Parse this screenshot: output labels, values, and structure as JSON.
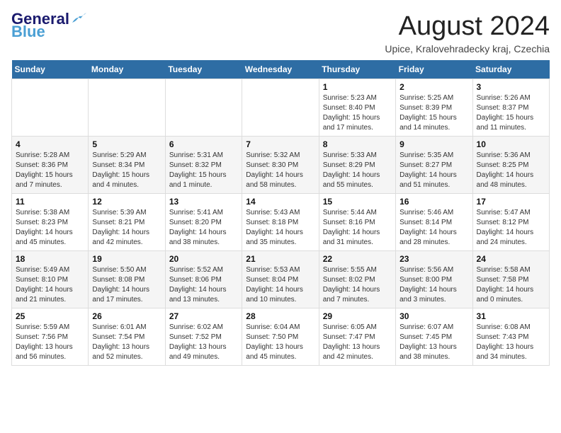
{
  "header": {
    "logo_line1": "General",
    "logo_line2": "Blue",
    "month_title": "August 2024",
    "location": "Upice, Kralovehradecky kraj, Czechia"
  },
  "weekdays": [
    "Sunday",
    "Monday",
    "Tuesday",
    "Wednesday",
    "Thursday",
    "Friday",
    "Saturday"
  ],
  "weeks": [
    [
      {
        "day": "",
        "info": ""
      },
      {
        "day": "",
        "info": ""
      },
      {
        "day": "",
        "info": ""
      },
      {
        "day": "",
        "info": ""
      },
      {
        "day": "1",
        "info": "Sunrise: 5:23 AM\nSunset: 8:40 PM\nDaylight: 15 hours and 17 minutes."
      },
      {
        "day": "2",
        "info": "Sunrise: 5:25 AM\nSunset: 8:39 PM\nDaylight: 15 hours and 14 minutes."
      },
      {
        "day": "3",
        "info": "Sunrise: 5:26 AM\nSunset: 8:37 PM\nDaylight: 15 hours and 11 minutes."
      }
    ],
    [
      {
        "day": "4",
        "info": "Sunrise: 5:28 AM\nSunset: 8:36 PM\nDaylight: 15 hours and 7 minutes."
      },
      {
        "day": "5",
        "info": "Sunrise: 5:29 AM\nSunset: 8:34 PM\nDaylight: 15 hours and 4 minutes."
      },
      {
        "day": "6",
        "info": "Sunrise: 5:31 AM\nSunset: 8:32 PM\nDaylight: 15 hours and 1 minute."
      },
      {
        "day": "7",
        "info": "Sunrise: 5:32 AM\nSunset: 8:30 PM\nDaylight: 14 hours and 58 minutes."
      },
      {
        "day": "8",
        "info": "Sunrise: 5:33 AM\nSunset: 8:29 PM\nDaylight: 14 hours and 55 minutes."
      },
      {
        "day": "9",
        "info": "Sunrise: 5:35 AM\nSunset: 8:27 PM\nDaylight: 14 hours and 51 minutes."
      },
      {
        "day": "10",
        "info": "Sunrise: 5:36 AM\nSunset: 8:25 PM\nDaylight: 14 hours and 48 minutes."
      }
    ],
    [
      {
        "day": "11",
        "info": "Sunrise: 5:38 AM\nSunset: 8:23 PM\nDaylight: 14 hours and 45 minutes."
      },
      {
        "day": "12",
        "info": "Sunrise: 5:39 AM\nSunset: 8:21 PM\nDaylight: 14 hours and 42 minutes."
      },
      {
        "day": "13",
        "info": "Sunrise: 5:41 AM\nSunset: 8:20 PM\nDaylight: 14 hours and 38 minutes."
      },
      {
        "day": "14",
        "info": "Sunrise: 5:43 AM\nSunset: 8:18 PM\nDaylight: 14 hours and 35 minutes."
      },
      {
        "day": "15",
        "info": "Sunrise: 5:44 AM\nSunset: 8:16 PM\nDaylight: 14 hours and 31 minutes."
      },
      {
        "day": "16",
        "info": "Sunrise: 5:46 AM\nSunset: 8:14 PM\nDaylight: 14 hours and 28 minutes."
      },
      {
        "day": "17",
        "info": "Sunrise: 5:47 AM\nSunset: 8:12 PM\nDaylight: 14 hours and 24 minutes."
      }
    ],
    [
      {
        "day": "18",
        "info": "Sunrise: 5:49 AM\nSunset: 8:10 PM\nDaylight: 14 hours and 21 minutes."
      },
      {
        "day": "19",
        "info": "Sunrise: 5:50 AM\nSunset: 8:08 PM\nDaylight: 14 hours and 17 minutes."
      },
      {
        "day": "20",
        "info": "Sunrise: 5:52 AM\nSunset: 8:06 PM\nDaylight: 14 hours and 13 minutes."
      },
      {
        "day": "21",
        "info": "Sunrise: 5:53 AM\nSunset: 8:04 PM\nDaylight: 14 hours and 10 minutes."
      },
      {
        "day": "22",
        "info": "Sunrise: 5:55 AM\nSunset: 8:02 PM\nDaylight: 14 hours and 7 minutes."
      },
      {
        "day": "23",
        "info": "Sunrise: 5:56 AM\nSunset: 8:00 PM\nDaylight: 14 hours and 3 minutes."
      },
      {
        "day": "24",
        "info": "Sunrise: 5:58 AM\nSunset: 7:58 PM\nDaylight: 14 hours and 0 minutes."
      }
    ],
    [
      {
        "day": "25",
        "info": "Sunrise: 5:59 AM\nSunset: 7:56 PM\nDaylight: 13 hours and 56 minutes."
      },
      {
        "day": "26",
        "info": "Sunrise: 6:01 AM\nSunset: 7:54 PM\nDaylight: 13 hours and 52 minutes."
      },
      {
        "day": "27",
        "info": "Sunrise: 6:02 AM\nSunset: 7:52 PM\nDaylight: 13 hours and 49 minutes."
      },
      {
        "day": "28",
        "info": "Sunrise: 6:04 AM\nSunset: 7:50 PM\nDaylight: 13 hours and 45 minutes."
      },
      {
        "day": "29",
        "info": "Sunrise: 6:05 AM\nSunset: 7:47 PM\nDaylight: 13 hours and 42 minutes."
      },
      {
        "day": "30",
        "info": "Sunrise: 6:07 AM\nSunset: 7:45 PM\nDaylight: 13 hours and 38 minutes."
      },
      {
        "day": "31",
        "info": "Sunrise: 6:08 AM\nSunset: 7:43 PM\nDaylight: 13 hours and 34 minutes."
      }
    ]
  ]
}
